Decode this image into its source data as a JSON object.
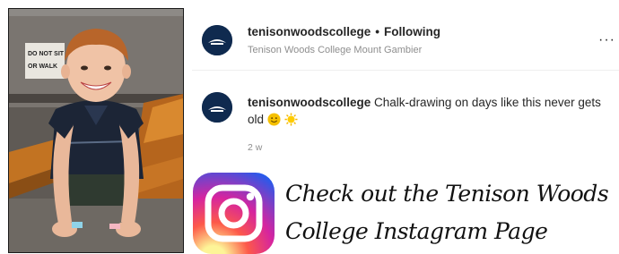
{
  "post": {
    "header": {
      "username": "tenisonwoodscollege",
      "separator": "•",
      "follow_status": "Following",
      "location": "Tenison Woods College Mount Gambier",
      "more": "···"
    },
    "caption": {
      "username": "tenisonwoodscollege",
      "text": "Chalk-drawing on days like this never gets old",
      "emojis": [
        "slightly-smiling-face",
        "sun"
      ],
      "time": "2 w"
    }
  },
  "photo": {
    "sign_line1": "DO NOT SIT",
    "sign_line2": "OR WALK"
  },
  "cta": {
    "line1": "Check out the Tenison Woods",
    "line2": "College Instagram Page"
  },
  "colors": {
    "avatar_bg": "#0f2a4f",
    "muted_text": "#8e8e8e",
    "instagram_gradient": [
      "#feda75",
      "#fa7e1e",
      "#d62976",
      "#962fbf",
      "#4f5bd5"
    ]
  }
}
